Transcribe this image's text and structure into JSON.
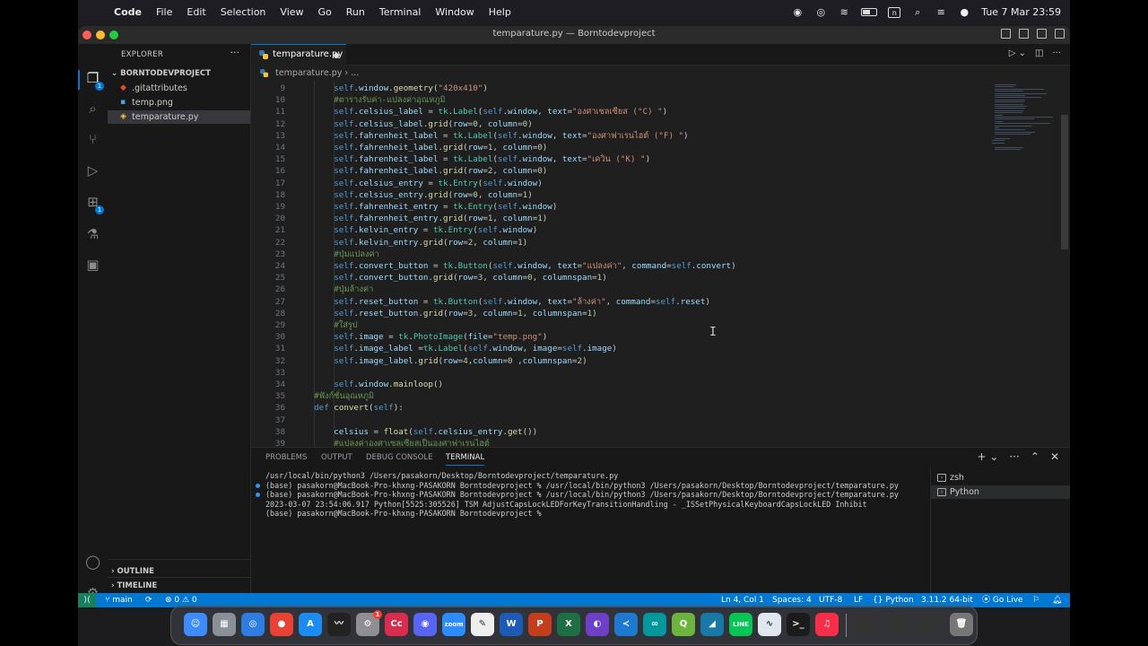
{
  "menubar": {
    "apple": "",
    "app": "Code",
    "items": [
      "File",
      "Edit",
      "Selection",
      "View",
      "Go",
      "Run",
      "Terminal",
      "Window",
      "Help"
    ],
    "clock": "Tue 7 Mar  23:59",
    "input_indicator": "n"
  },
  "window": {
    "title": "temparature.py — Borntodevproject"
  },
  "explorer": {
    "title": "EXPLORER",
    "more": "···",
    "project": "BORNTODEVPROJECT",
    "files": [
      {
        "name": ".gitattributes",
        "icon": "git-icon",
        "color": "#e44d26"
      },
      {
        "name": "temp.png",
        "icon": "image-icon",
        "color": "#4fa5d6"
      },
      {
        "name": "temparature.py",
        "icon": "python-icon",
        "color": "#3776ab"
      }
    ],
    "outline": "OUTLINE",
    "timeline": "TIMELINE",
    "badge_explorer": "1",
    "badge_extensions": "1"
  },
  "editor": {
    "tab": "temparature.py",
    "breadcrumb_file": "temparature.py",
    "breadcrumb_more": "...",
    "lines": [
      {
        "n": "9",
        "t": "        self.window.geometry(\"420x410\")"
      },
      {
        "n": "10",
        "t": "        #ตารางรับค่า-แปลงค่าอุณหภูมิ"
      },
      {
        "n": "11",
        "t": "        self.celsius_label = tk.Label(self.window, text=\"องศาเซลเซียส (°C) \")"
      },
      {
        "n": "12",
        "t": "        self.celsius_label.grid(row=0, column=0)"
      },
      {
        "n": "13",
        "t": "        self.fahrenheit_label = tk.Label(self.window, text=\"องศาฟาเรนไฮต์ (°F) \")"
      },
      {
        "n": "14",
        "t": "        self.fahrenheit_label.grid(row=1, column=0)"
      },
      {
        "n": "15",
        "t": "        self.fahrenheit_label = tk.Label(self.window, text=\"เควิน (°K) \")"
      },
      {
        "n": "16",
        "t": "        self.fahrenheit_label.grid(row=2, column=0)"
      },
      {
        "n": "17",
        "t": "        self.celsius_entry = tk.Entry(self.window)"
      },
      {
        "n": "18",
        "t": "        self.celsius_entry.grid(row=0, column=1)"
      },
      {
        "n": "19",
        "t": "        self.fahrenheit_entry = tk.Entry(self.window)"
      },
      {
        "n": "20",
        "t": "        self.fahrenheit_entry.grid(row=1, column=1)"
      },
      {
        "n": "21",
        "t": "        self.kelvin_entry = tk.Entry(self.window)"
      },
      {
        "n": "22",
        "t": "        self.kelvin_entry.grid(row=2, column=1)"
      },
      {
        "n": "23",
        "t": "        #ปุ่มแปลงค่า"
      },
      {
        "n": "24",
        "t": "        self.convert_button = tk.Button(self.window, text=\"แปลงค่า\", command=self.convert)"
      },
      {
        "n": "25",
        "t": "        self.convert_button.grid(row=3, column=0, columnspan=1)"
      },
      {
        "n": "26",
        "t": "        #ปุ่มล้างค่า"
      },
      {
        "n": "27",
        "t": "        self.reset_button = tk.Button(self.window, text=\"ล้างค่า\", command=self.reset)"
      },
      {
        "n": "28",
        "t": "        self.reset_button.grid(row=3, column=1, columnspan=1)"
      },
      {
        "n": "29",
        "t": "        #ใส่รูป"
      },
      {
        "n": "30",
        "t": "        self.image = tk.PhotoImage(file=\"temp.png\")"
      },
      {
        "n": "31",
        "t": "        self.image_label =tk.Label(self.window, image=self.image)"
      },
      {
        "n": "32",
        "t": "        self.image_label.grid(row=4,column=0 ,columnspan=2)"
      },
      {
        "n": "33",
        "t": ""
      },
      {
        "n": "34",
        "t": "        self.window.mainloop()"
      },
      {
        "n": "35",
        "t": "    #ฟังก์ชั่นอุณหภูมิ"
      },
      {
        "n": "36",
        "t": "    def convert(self):"
      },
      {
        "n": "37",
        "t": ""
      },
      {
        "n": "38",
        "t": "        celsius = float(self.celsius_entry.get())"
      },
      {
        "n": "39",
        "t": "        #แปลงค่าองศาเซลเซียสเป็นองศาฟาเรนไฮต์"
      }
    ],
    "colors": {
      "keyword": "#569cd6",
      "function": "#dcdcaa",
      "class": "#4ec9b0",
      "string": "#ce9178",
      "comment": "#6a9955",
      "param": "#9cdcfe",
      "number": "#b5cea8",
      "self": "#569cd6"
    }
  },
  "panel": {
    "tabs": [
      "PROBLEMS",
      "OUTPUT",
      "DEBUG CONSOLE",
      "TERMINAL"
    ],
    "terminal_lines": [
      {
        "dot": false,
        "t": "/usr/local/bin/python3 /Users/pasakorn/Desktop/Borntodevproject/temparature.py"
      },
      {
        "dot": true,
        "t": "(base) pasakorn@MacBook-Pro-khxng-PASAKORN Borntodevproject % /usr/local/bin/python3 /Users/pasakorn/Desktop/Borntodevproject/temparature.py"
      },
      {
        "dot": true,
        "t": "(base) pasakorn@MacBook-Pro-khxng-PASAKORN Borntodevproject % /usr/local/bin/python3 /Users/pasakorn/Desktop/Borntodevproject/temparature.py"
      },
      {
        "dot": false,
        "t": "2023-03-07 23:54:06.917 Python[5525:305526] TSM AdjustCapsLockLEDForKeyTransitionHandling - _ISSetPhysicalKeyboardCapsLockLED Inhibit"
      },
      {
        "dot": false,
        "t": "(base) pasakorn@MacBook-Pro-khxng-PASAKORN Borntodevproject % "
      }
    ],
    "terminals": [
      "zsh",
      "Python"
    ]
  },
  "statusbar": {
    "branch": "main",
    "problems": "⊗ 0 ⚠ 0",
    "position": "Ln 4, Col 1",
    "spaces": "Spaces: 4",
    "encoding": "UTF-8",
    "eol": "LF",
    "language": "Python",
    "interpreter": "3.11.2 64-bit",
    "golive": "Go Live"
  },
  "dock": {
    "apps": [
      {
        "name": "finder",
        "bg": "#3d8bfd",
        "g": "☺"
      },
      {
        "name": "launchpad",
        "bg": "#8a8f98",
        "g": "▦"
      },
      {
        "name": "safari",
        "bg": "#2f7de1",
        "g": "◎"
      },
      {
        "name": "chrome",
        "bg": "#e94235",
        "g": "●"
      },
      {
        "name": "app-store",
        "bg": "#1b8df2",
        "g": "A"
      },
      {
        "name": "activity-monitor",
        "bg": "#222",
        "g": "〰"
      },
      {
        "name": "system-settings",
        "bg": "#8e8e93",
        "g": "⚙"
      },
      {
        "name": "creative-cloud",
        "bg": "#d92c4f",
        "g": "Cc"
      },
      {
        "name": "discord",
        "bg": "#5865f2",
        "g": "◉"
      },
      {
        "name": "zoom",
        "bg": "#2d8cff",
        "g": "zoom"
      },
      {
        "name": "textedit",
        "bg": "#eee",
        "g": "✎"
      },
      {
        "name": "word",
        "bg": "#1e5bb8",
        "g": "W"
      },
      {
        "name": "powerpoint",
        "bg": "#c43e1c",
        "g": "P"
      },
      {
        "name": "excel",
        "bg": "#1d7044",
        "g": "X"
      },
      {
        "name": "github-desktop",
        "bg": "#6e40c9",
        "g": "◐"
      },
      {
        "name": "vscode",
        "bg": "#1e7ad1",
        "g": "≺"
      },
      {
        "name": "arduino",
        "bg": "#00979d",
        "g": "∞"
      },
      {
        "name": "qgis",
        "bg": "#6db33f",
        "g": "Q"
      },
      {
        "name": "wireshark",
        "bg": "#1679a7",
        "g": "◢"
      },
      {
        "name": "line",
        "bg": "#06c755",
        "g": "LINE"
      },
      {
        "name": "grapher",
        "bg": "#dfe6ef",
        "g": "∿"
      },
      {
        "name": "terminal",
        "bg": "#1b1b1b",
        "g": ">_"
      },
      {
        "name": "music",
        "bg": "#fa2d48",
        "g": "♫"
      },
      {
        "name": "window-thumb",
        "bg": "#333",
        "g": ""
      },
      {
        "name": "window-thumb-2",
        "bg": "#333",
        "g": ""
      },
      {
        "name": "window-thumb-3",
        "bg": "#333",
        "g": ""
      },
      {
        "name": "trash",
        "bg": "#777",
        "g": "🗑"
      }
    ],
    "settings_badge": "1"
  }
}
